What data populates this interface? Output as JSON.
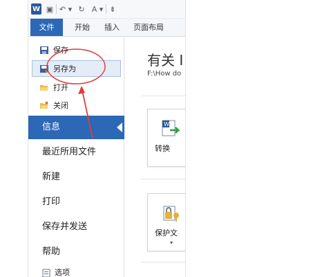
{
  "qat": {
    "app_icon_letter": "W",
    "save_glyph": "▣",
    "undo_glyph": "↶ ▾",
    "redo_glyph": "↻",
    "font_glyph": "A ▾",
    "more_glyph": "⇟"
  },
  "ribbon": {
    "tabs": [
      {
        "label": "文件",
        "active": true
      },
      {
        "label": "开始"
      },
      {
        "label": "插入"
      },
      {
        "label": "页面布局"
      }
    ]
  },
  "backstage": {
    "small_commands": [
      {
        "label": "保存",
        "icon": "save-icon"
      },
      {
        "label": "另存为",
        "icon": "save-as-icon",
        "highlighted": true
      },
      {
        "label": "打开",
        "icon": "open-folder-icon"
      },
      {
        "label": "关闭",
        "icon": "close-folder-icon"
      }
    ],
    "big_commands": [
      {
        "label": "信息",
        "active": true
      },
      {
        "label": "最近所用文件"
      },
      {
        "label": "新建"
      },
      {
        "label": "打印"
      },
      {
        "label": "保存并发送"
      },
      {
        "label": "帮助"
      }
    ],
    "options_label": "选项"
  },
  "info": {
    "title": "有关 I",
    "path": "F:\\How do"
  },
  "tiles": [
    {
      "label": "转换",
      "icon": "convert-doc-icon"
    },
    {
      "label": "保护文",
      "icon": "protect-doc-icon",
      "dropdown": "▾"
    }
  ],
  "colors": {
    "accent": "#2c68b5",
    "annotation": "#e03c3c",
    "highlight_bg": "#e4ecf7"
  }
}
